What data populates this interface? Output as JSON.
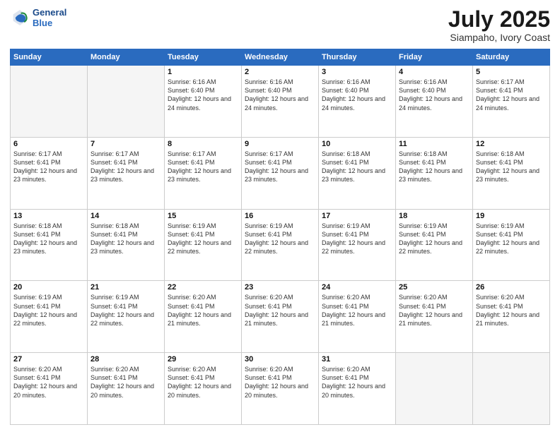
{
  "header": {
    "logo_line1": "General",
    "logo_line2": "Blue",
    "title": "July 2025",
    "subtitle": "Siampaho, Ivory Coast"
  },
  "days_of_week": [
    "Sunday",
    "Monday",
    "Tuesday",
    "Wednesday",
    "Thursday",
    "Friday",
    "Saturday"
  ],
  "weeks": [
    [
      {
        "day": "",
        "info": ""
      },
      {
        "day": "",
        "info": ""
      },
      {
        "day": "1",
        "info": "Sunrise: 6:16 AM\nSunset: 6:40 PM\nDaylight: 12 hours\nand 24 minutes."
      },
      {
        "day": "2",
        "info": "Sunrise: 6:16 AM\nSunset: 6:40 PM\nDaylight: 12 hours\nand 24 minutes."
      },
      {
        "day": "3",
        "info": "Sunrise: 6:16 AM\nSunset: 6:40 PM\nDaylight: 12 hours\nand 24 minutes."
      },
      {
        "day": "4",
        "info": "Sunrise: 6:16 AM\nSunset: 6:40 PM\nDaylight: 12 hours\nand 24 minutes."
      },
      {
        "day": "5",
        "info": "Sunrise: 6:17 AM\nSunset: 6:41 PM\nDaylight: 12 hours\nand 24 minutes."
      }
    ],
    [
      {
        "day": "6",
        "info": "Sunrise: 6:17 AM\nSunset: 6:41 PM\nDaylight: 12 hours\nand 23 minutes."
      },
      {
        "day": "7",
        "info": "Sunrise: 6:17 AM\nSunset: 6:41 PM\nDaylight: 12 hours\nand 23 minutes."
      },
      {
        "day": "8",
        "info": "Sunrise: 6:17 AM\nSunset: 6:41 PM\nDaylight: 12 hours\nand 23 minutes."
      },
      {
        "day": "9",
        "info": "Sunrise: 6:17 AM\nSunset: 6:41 PM\nDaylight: 12 hours\nand 23 minutes."
      },
      {
        "day": "10",
        "info": "Sunrise: 6:18 AM\nSunset: 6:41 PM\nDaylight: 12 hours\nand 23 minutes."
      },
      {
        "day": "11",
        "info": "Sunrise: 6:18 AM\nSunset: 6:41 PM\nDaylight: 12 hours\nand 23 minutes."
      },
      {
        "day": "12",
        "info": "Sunrise: 6:18 AM\nSunset: 6:41 PM\nDaylight: 12 hours\nand 23 minutes."
      }
    ],
    [
      {
        "day": "13",
        "info": "Sunrise: 6:18 AM\nSunset: 6:41 PM\nDaylight: 12 hours\nand 23 minutes."
      },
      {
        "day": "14",
        "info": "Sunrise: 6:18 AM\nSunset: 6:41 PM\nDaylight: 12 hours\nand 23 minutes."
      },
      {
        "day": "15",
        "info": "Sunrise: 6:19 AM\nSunset: 6:41 PM\nDaylight: 12 hours\nand 22 minutes."
      },
      {
        "day": "16",
        "info": "Sunrise: 6:19 AM\nSunset: 6:41 PM\nDaylight: 12 hours\nand 22 minutes."
      },
      {
        "day": "17",
        "info": "Sunrise: 6:19 AM\nSunset: 6:41 PM\nDaylight: 12 hours\nand 22 minutes."
      },
      {
        "day": "18",
        "info": "Sunrise: 6:19 AM\nSunset: 6:41 PM\nDaylight: 12 hours\nand 22 minutes."
      },
      {
        "day": "19",
        "info": "Sunrise: 6:19 AM\nSunset: 6:41 PM\nDaylight: 12 hours\nand 22 minutes."
      }
    ],
    [
      {
        "day": "20",
        "info": "Sunrise: 6:19 AM\nSunset: 6:41 PM\nDaylight: 12 hours\nand 22 minutes."
      },
      {
        "day": "21",
        "info": "Sunrise: 6:19 AM\nSunset: 6:41 PM\nDaylight: 12 hours\nand 22 minutes."
      },
      {
        "day": "22",
        "info": "Sunrise: 6:20 AM\nSunset: 6:41 PM\nDaylight: 12 hours\nand 21 minutes."
      },
      {
        "day": "23",
        "info": "Sunrise: 6:20 AM\nSunset: 6:41 PM\nDaylight: 12 hours\nand 21 minutes."
      },
      {
        "day": "24",
        "info": "Sunrise: 6:20 AM\nSunset: 6:41 PM\nDaylight: 12 hours\nand 21 minutes."
      },
      {
        "day": "25",
        "info": "Sunrise: 6:20 AM\nSunset: 6:41 PM\nDaylight: 12 hours\nand 21 minutes."
      },
      {
        "day": "26",
        "info": "Sunrise: 6:20 AM\nSunset: 6:41 PM\nDaylight: 12 hours\nand 21 minutes."
      }
    ],
    [
      {
        "day": "27",
        "info": "Sunrise: 6:20 AM\nSunset: 6:41 PM\nDaylight: 12 hours\nand 20 minutes."
      },
      {
        "day": "28",
        "info": "Sunrise: 6:20 AM\nSunset: 6:41 PM\nDaylight: 12 hours\nand 20 minutes."
      },
      {
        "day": "29",
        "info": "Sunrise: 6:20 AM\nSunset: 6:41 PM\nDaylight: 12 hours\nand 20 minutes."
      },
      {
        "day": "30",
        "info": "Sunrise: 6:20 AM\nSunset: 6:41 PM\nDaylight: 12 hours\nand 20 minutes."
      },
      {
        "day": "31",
        "info": "Sunrise: 6:20 AM\nSunset: 6:41 PM\nDaylight: 12 hours\nand 20 minutes."
      },
      {
        "day": "",
        "info": ""
      },
      {
        "day": "",
        "info": ""
      }
    ]
  ],
  "colors": {
    "header_bg": "#2a6bbf",
    "header_text": "#ffffff",
    "accent": "#1a4a8a"
  }
}
